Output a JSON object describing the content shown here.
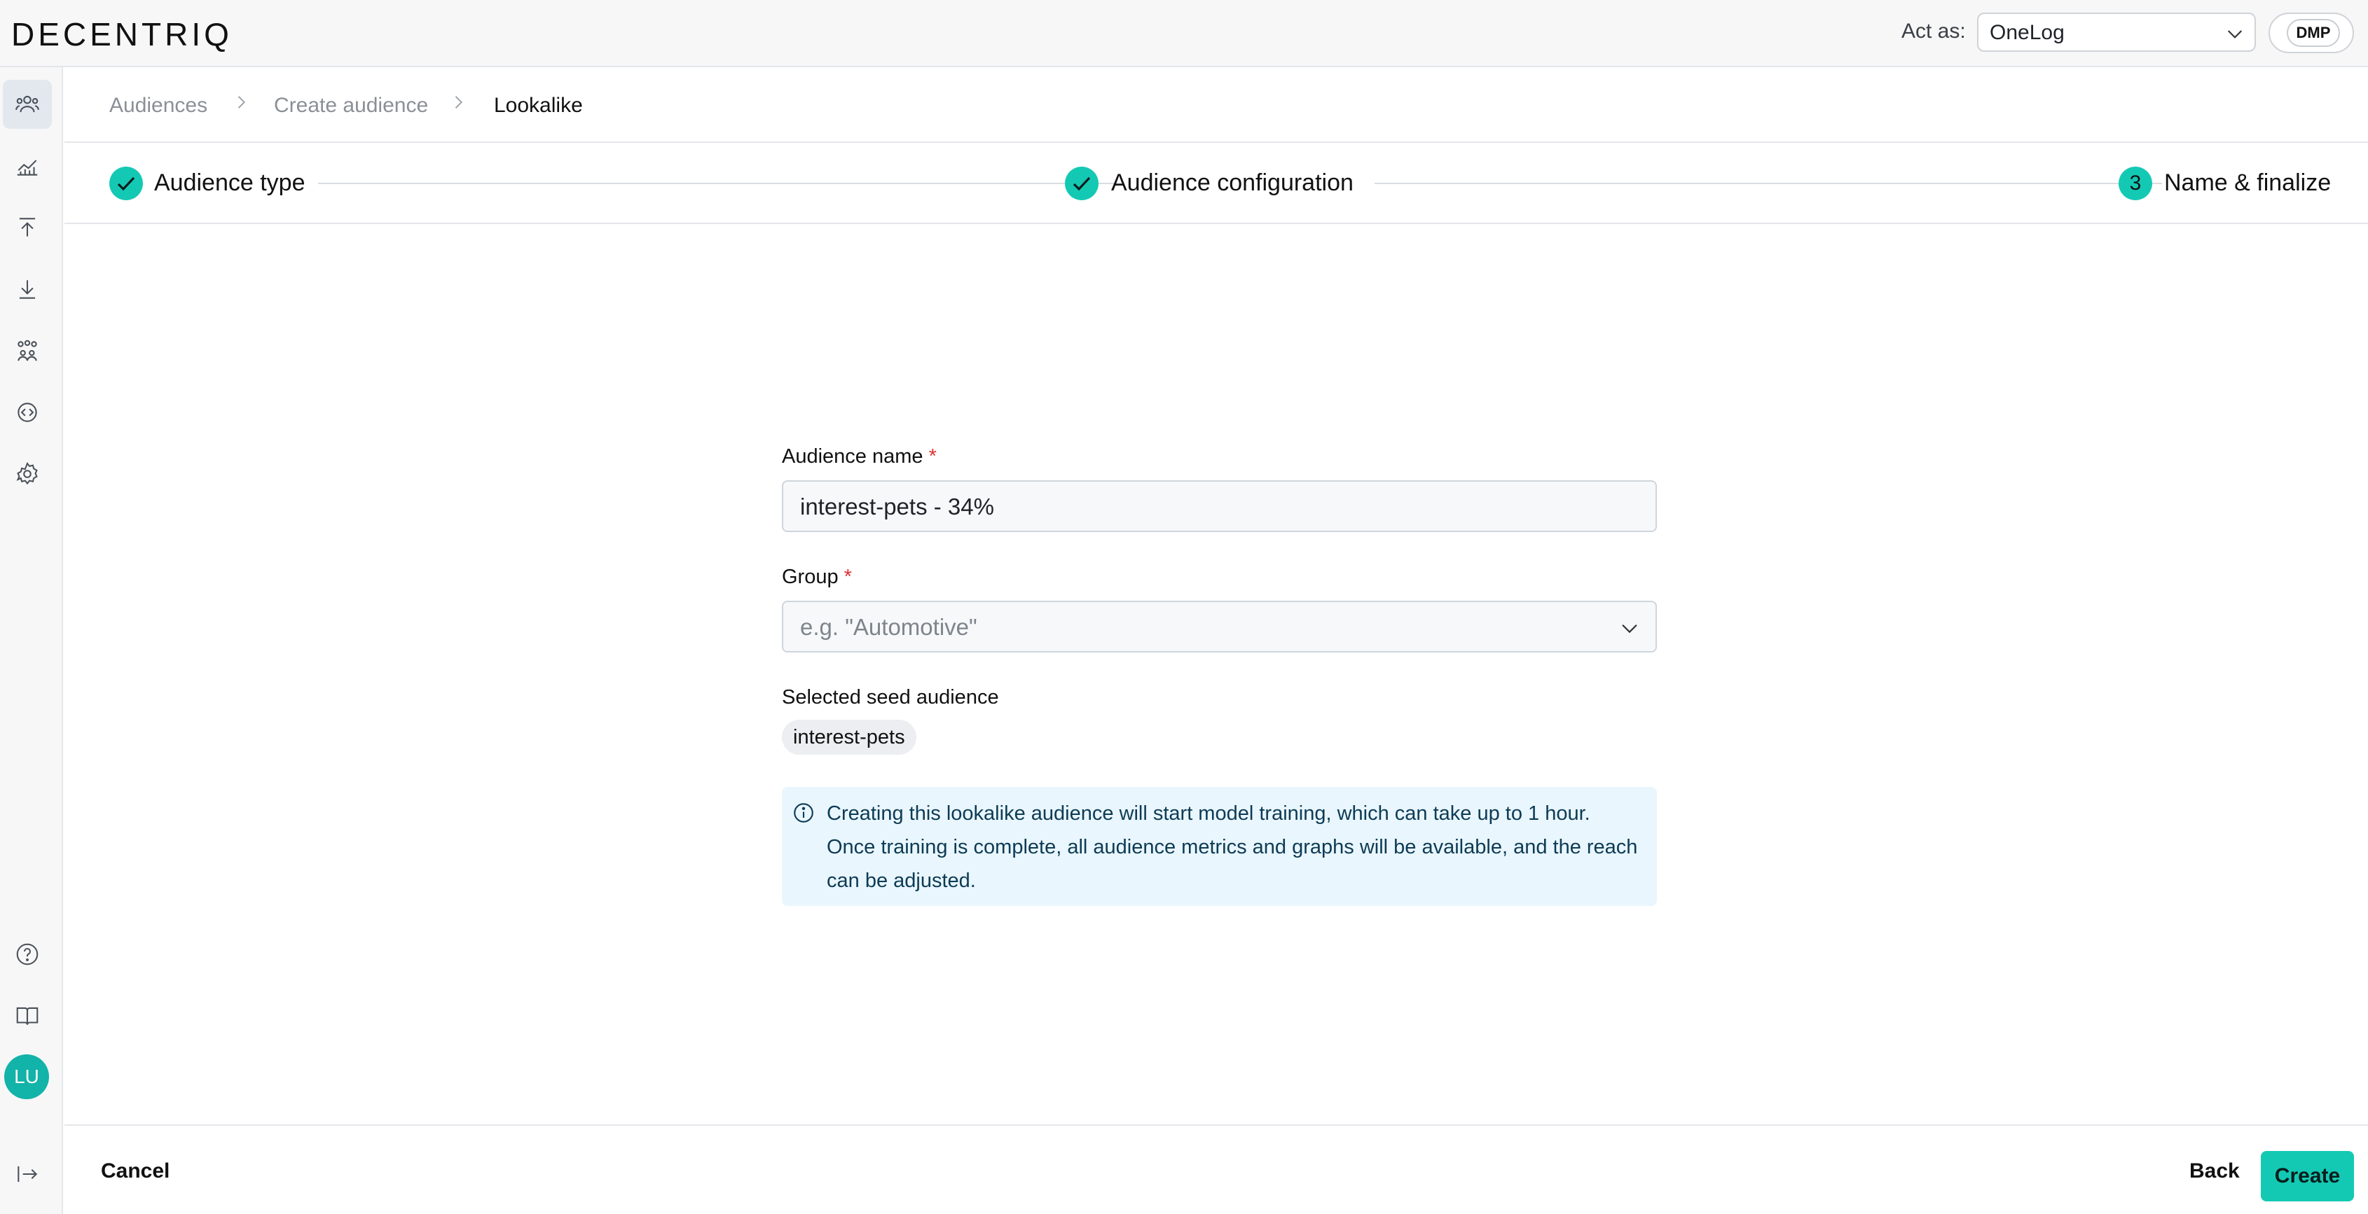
{
  "topbar": {
    "logo": "DECENTRIQ",
    "act_as_label": "Act as:",
    "act_as_value": "OneLog",
    "mode_badge": "DMP"
  },
  "sidebar": {
    "items": [
      {
        "icon": "audiences-icon",
        "active": true
      },
      {
        "icon": "insights-chart-icon",
        "active": false
      },
      {
        "icon": "upload-icon",
        "active": false
      },
      {
        "icon": "download-icon",
        "active": false
      },
      {
        "icon": "group-people-icon",
        "active": false
      },
      {
        "icon": "developer-code-icon",
        "active": false
      },
      {
        "icon": "settings-gear-icon",
        "active": false
      }
    ],
    "bottom_items": [
      {
        "icon": "help-icon"
      },
      {
        "icon": "docs-book-icon"
      }
    ],
    "avatar_initials": "LU",
    "collapse_icon": "collapse-arrow-icon"
  },
  "breadcrumb": {
    "items": [
      "Audiences",
      "Create audience",
      "Lookalike"
    ]
  },
  "stepper": {
    "steps": [
      {
        "label": "Audience type",
        "state": "done"
      },
      {
        "label": "Audience configuration",
        "state": "done"
      },
      {
        "number": "3",
        "label": "Name & finalize",
        "state": "current"
      }
    ]
  },
  "form": {
    "name_label": "Audience name",
    "required_mark": "*",
    "name_value": "interest-pets - 34%",
    "group_label": "Group",
    "group_placeholder": "e.g. \"Automotive\"",
    "seed_label": "Selected seed audience",
    "seed_chip": "interest-pets",
    "info_text": "Creating this lookalike audience will start model training, which can take up to 1 hour. Once training is complete, all audience metrics and graphs will be available, and the reach can be adjusted."
  },
  "footer": {
    "cancel_label": "Cancel",
    "back_label": "Back",
    "create_label": "Create"
  },
  "colors": {
    "accent": "#14c9b4",
    "info_bg": "#e9f6fd",
    "required": "#e0312f"
  }
}
